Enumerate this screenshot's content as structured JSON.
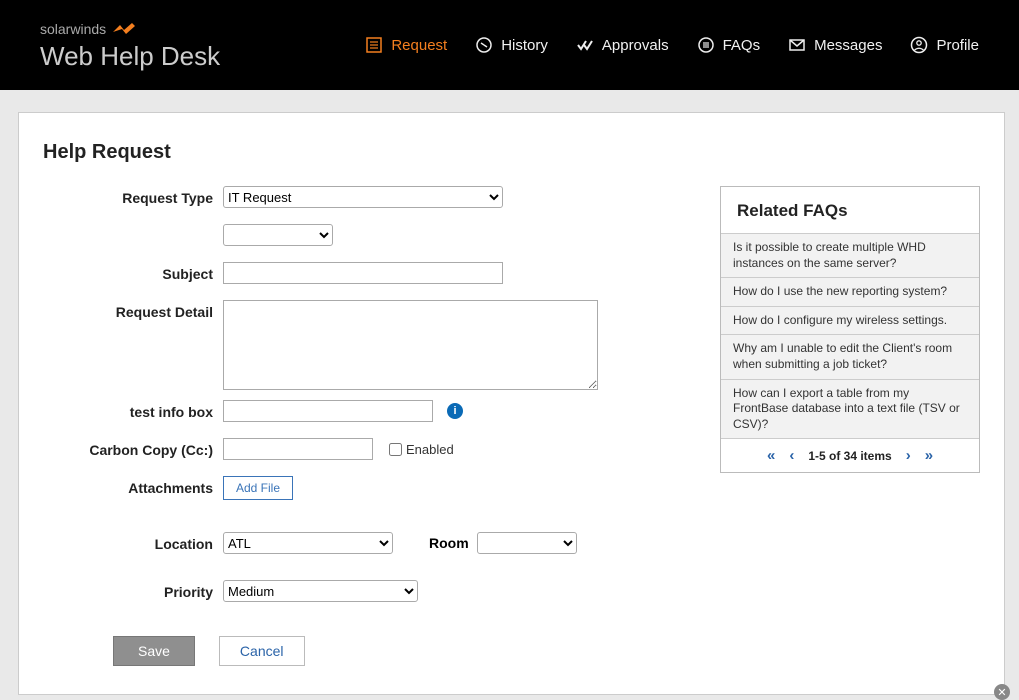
{
  "brand": {
    "top": "solarwinds",
    "title": "Web Help Desk"
  },
  "nav": {
    "request": "Request",
    "history": "History",
    "approvals": "Approvals",
    "faqs": "FAQs",
    "messages": "Messages",
    "profile": "Profile"
  },
  "page": {
    "title": "Help Request",
    "labels": {
      "request_type": "Request Type",
      "subject": "Subject",
      "request_detail": "Request Detail",
      "test_info_box": "test info box",
      "carbon_copy": "Carbon Copy (Cc:)",
      "enabled": "Enabled",
      "attachments": "Attachments",
      "add_file": "Add File",
      "location": "Location",
      "room": "Room",
      "priority": "Priority",
      "save": "Save",
      "cancel": "Cancel"
    },
    "values": {
      "request_type": "IT Request",
      "secondary_type": "",
      "subject": "",
      "request_detail": "",
      "test_info_box": "",
      "carbon_copy": "",
      "enabled": false,
      "location": "ATL",
      "room": "",
      "priority": "Medium"
    }
  },
  "faq": {
    "title": "Related FAQs",
    "items": [
      "Is it possible to create multiple WHD instances on the same server?",
      "How do I use the new reporting system?",
      "How do I configure my wireless settings.",
      "Why am I unable to edit the Client's room when submitting a job ticket?",
      "How can I export a table from my FrontBase database into a text file (TSV or CSV)?"
    ],
    "pager": "1-5 of 34 items"
  }
}
